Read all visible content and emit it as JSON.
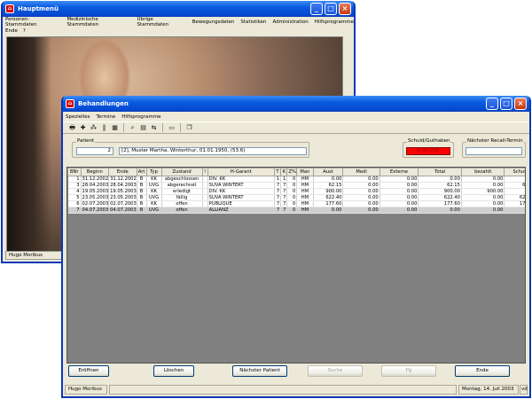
{
  "main_window": {
    "title": "Hauptmenü",
    "app_icon": "app-logo-icon",
    "menu": [
      "Personen-Stammdaten",
      "Medizinische Stammdaten",
      "Übrige Stammdaten",
      "Bewegungsdaten",
      "Statistiken",
      "Administration",
      "Hilfsprogramme"
    ],
    "menu2": [
      "Ende",
      "?"
    ],
    "status_user": "Hugo Moribus"
  },
  "behandlungen": {
    "title": "Behandlungen",
    "menu": [
      "Spezielles",
      "Termine",
      "Hilfsprogramme"
    ],
    "toolbar_icons": [
      "print-icon",
      "add-icon",
      "network-icon",
      "pause-icon",
      "calendar-icon",
      "preview-icon",
      "document-icon",
      "transfer-icon",
      "folder-icon",
      "copy-icon"
    ],
    "patient": {
      "label": "Patient",
      "number": "2",
      "description": "[2], Muster Martha, Winterthur, 01.01.1950, (53.6)"
    },
    "schuld": {
      "label": "Schuld/Guthaben",
      "value": "0.00 CHF",
      "color": "#ff0000"
    },
    "recall": {
      "label": "Nächster Recall-Termin",
      "value": ""
    },
    "columns": [
      "BNr",
      "Beginn",
      "Ende",
      "Art",
      "Typ",
      "Zustand",
      "!",
      "H-Garant",
      "T",
      "K",
      "Z%",
      "Man",
      "Aust",
      "Medi",
      "Externe",
      "Total",
      "bezahlt",
      "Schuld"
    ],
    "rows": [
      [
        "1",
        "31.12.2002",
        "31.12.2002",
        "B",
        "KK",
        "abgeschlossen",
        "",
        "DIV. KK",
        "1",
        "1",
        "0",
        "HM",
        "0.00",
        "0.00",
        "0.00",
        "0.00",
        "0.00",
        "0.00"
      ],
      [
        "3",
        "28.04.2003",
        "28.04.2003",
        "B",
        "UVG",
        "abgerechnet",
        "",
        "SUVA WINTERT",
        "7",
        "7",
        "0",
        "HM",
        "62.15",
        "0.00",
        "0.00",
        "62.15",
        "0.00",
        "62.15"
      ],
      [
        "4",
        "19.05.2003",
        "19.05.2003",
        "B",
        "KK",
        "erledigt",
        "",
        "DIV. KK",
        "7",
        "7",
        "0",
        "HM",
        "900.00",
        "0.00",
        "0.00",
        "900.00",
        "900.00",
        "0.00"
      ],
      [
        "5",
        "23.05.2003",
        "23.05.2003",
        "B",
        "UVG",
        "fällig",
        "",
        "SUVA WINTERT",
        "7",
        "7",
        "0",
        "HM",
        "622.40",
        "0.00",
        "0.00",
        "622.40",
        "0.00",
        "622.40"
      ],
      [
        "6",
        "02.07.2003",
        "02.07.2003",
        "B",
        "KK",
        "offen",
        "",
        "PUBLIQUE",
        "7",
        "7",
        "0",
        "HM",
        "177.60",
        "0.00",
        "0.00",
        "177.60",
        "0.00",
        "177.60"
      ],
      [
        "7",
        "04.07.2003",
        "04.07.2003",
        "B",
        "UVG",
        "offen",
        "",
        "ALLIANZ",
        "7",
        "7",
        "0",
        "HM",
        "0.00",
        "0.00",
        "0.00",
        "0.00",
        "0.00",
        "0.00"
      ]
    ],
    "selected_row": 5,
    "buttons": [
      {
        "label": "Eröffnen",
        "enabled": true
      },
      {
        "label": "Löschen",
        "enabled": true
      },
      {
        "label": "Nächster Patient",
        "enabled": true
      },
      {
        "label": "Suche",
        "enabled": false
      },
      {
        "label": "Pg",
        "enabled": false
      },
      {
        "label": "Ende",
        "enabled": true
      }
    ],
    "status": {
      "user": "Hugo Moribus",
      "date": "Montag, 14. Juli 2003",
      "code": "vd"
    }
  }
}
